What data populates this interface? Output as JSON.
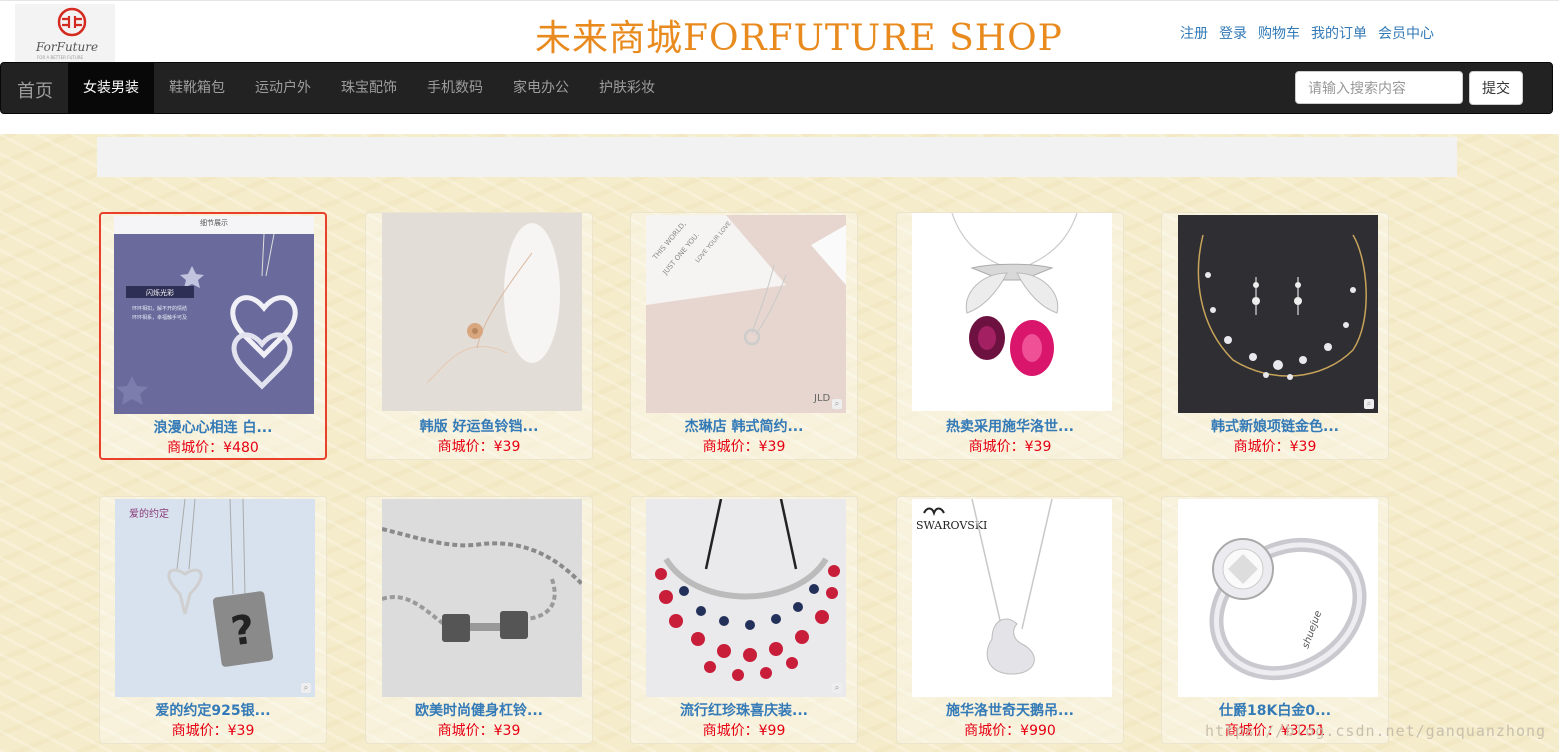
{
  "header": {
    "title": "未来商城FORFUTURE SHOP",
    "logo_text": "ForFuture",
    "logo_subtext": "FOR A BETTER FUTURE",
    "links": [
      "注册",
      "登录",
      "购物车",
      "我的订单",
      "会员中心"
    ]
  },
  "nav": {
    "brand": "首页",
    "items": [
      "女装男装",
      "鞋靴箱包",
      "运动户外",
      "珠宝配饰",
      "手机数码",
      "家电办公",
      "护肤彩妆"
    ],
    "active_index": 0,
    "search_placeholder": "请输入搜索内容",
    "submit_label": "提交"
  },
  "products": [
    {
      "name": "浪漫心心相连 白...",
      "price": "商城价：¥480",
      "image_text": [
        "细节展示",
        "闪烁光彩",
        "环环相扣，解不开的情结",
        "环环相系，幸福触手可及"
      ]
    },
    {
      "name": "韩版 好运鱼铃铛...",
      "price": "商城价：¥39"
    },
    {
      "name": "杰琳店 韩式简约...",
      "price": "商城价：¥39",
      "image_text": [
        "THIS WORLD,",
        "JUST ONE YOU.",
        "LOVE YOUR LOVE",
        "JLD"
      ]
    },
    {
      "name": "热卖采用施华洛世...",
      "price": "商城价：¥39"
    },
    {
      "name": "韩式新娘项链金色...",
      "price": "商城价：¥39"
    },
    {
      "name": "爱的约定925银...",
      "price": "商城价：¥39",
      "image_text": [
        "爱的约定"
      ]
    },
    {
      "name": "欧美时尚健身杠铃...",
      "price": "商城价：¥39"
    },
    {
      "name": "流行红珍珠喜庆装...",
      "price": "商城价：¥99"
    },
    {
      "name": "施华洛世奇天鹅吊...",
      "price": "商城价：¥990",
      "image_text": [
        "SWAROVSKI"
      ]
    },
    {
      "name": "仕爵18K白金0...",
      "price": "商城价：¥3251",
      "image_text": [
        "shuejue"
      ]
    }
  ],
  "watermark": "https://blog.csdn.net/ganquanzhong"
}
